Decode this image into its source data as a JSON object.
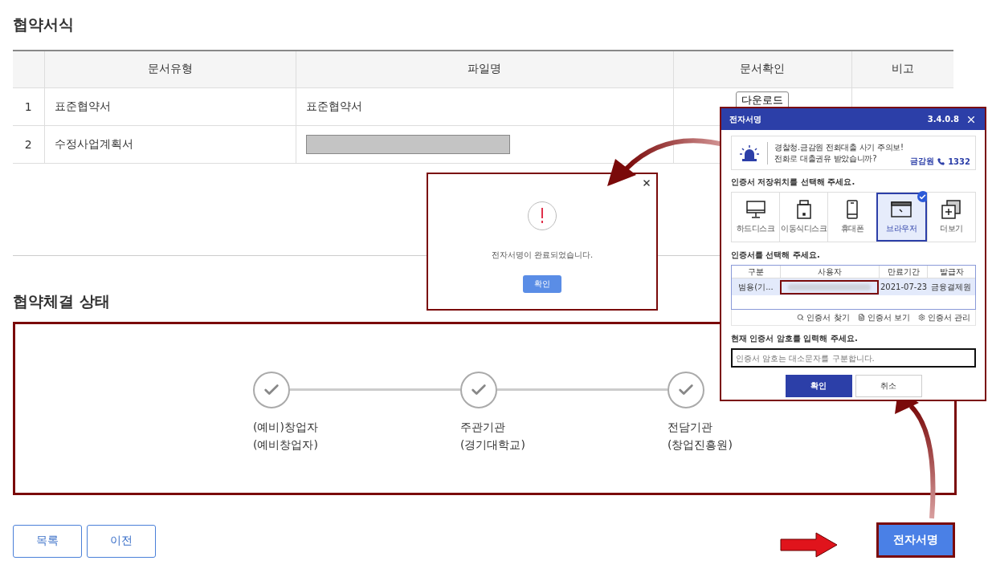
{
  "page_title": "협약서식",
  "doc_table": {
    "columns": [
      "문서유형",
      "파일명",
      "문서확인",
      "비고"
    ],
    "rows": [
      {
        "no": "1",
        "type": "표준협약서",
        "file": "표준협약서",
        "action": "다운로드"
      },
      {
        "no": "2",
        "type": "수정사업계획서",
        "file_redacted": true
      }
    ]
  },
  "status": {
    "title": "협약체결 상태",
    "steps": [
      {
        "label": "(예비)창업자",
        "sub": "(예비창업자)"
      },
      {
        "label": "주관기관",
        "sub": "(경기대학교)"
      },
      {
        "label": "전담기관",
        "sub": "(창업진흥원)"
      }
    ]
  },
  "buttons": [
    "목록",
    "이전"
  ],
  "sign_button": "전자서명",
  "alert": {
    "message": "전자서명이 완료되었습니다.",
    "button": "확인"
  },
  "sign_dialog": {
    "title": "전자서명",
    "version": "3.4.0.8",
    "notice": {
      "lines": [
        "경찰청.금감원 전화대출 사기 주의보!",
        "전화로 대출권유 받았습니까?"
      ],
      "org": "금감원",
      "phone": "1332"
    },
    "location_label": "인증서 저장위치를 선택해 주세요.",
    "locations": [
      {
        "kind": "disk",
        "label": "하드디스크",
        "selected": false
      },
      {
        "kind": "usb",
        "label": "이동식디스크",
        "selected": false
      },
      {
        "kind": "phone",
        "label": "휴대폰",
        "selected": false
      },
      {
        "kind": "browser",
        "label": "브라우저",
        "selected": true
      },
      {
        "kind": "more",
        "label": "더보기",
        "selected": false
      }
    ],
    "cert_label": "인증서를 선택해 주세요.",
    "cert_columns": [
      "구분",
      "사용자",
      "만료기간",
      "발급자"
    ],
    "certs": [
      {
        "type": "범용(기...",
        "user_redacted": true,
        "expires": "2021-07-23",
        "issuer": "금융결제원",
        "selected": true
      }
    ],
    "cert_actions": [
      {
        "kind": "search",
        "label": "인증서 찾기"
      },
      {
        "kind": "view",
        "label": "인증서 보기"
      },
      {
        "kind": "manage",
        "label": "인증서 관리"
      }
    ],
    "password_label": "현재 인증서 암호를 입력해 주세요.",
    "password_placeholder": "인증서 암호는 대소문자를 구분합니다.",
    "ok": "확인",
    "cancel": "취소"
  }
}
